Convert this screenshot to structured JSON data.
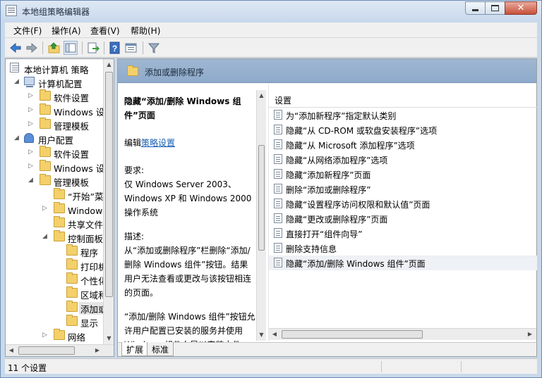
{
  "window": {
    "title": "本地组策略编辑器"
  },
  "menu": [
    "文件(F)",
    "操作(A)",
    "查看(V)",
    "帮助(H)"
  ],
  "toolbar": {
    "icons": [
      "back-arrow-icon",
      "forward-arrow-icon",
      "up-folder-icon",
      "show-hide-tree-icon",
      "export-list-icon",
      "help-icon",
      "properties-icon",
      "filter-icon"
    ]
  },
  "tree": {
    "items": [
      {
        "label": "本地计算机 策略"
      },
      {
        "label": "计算机配置"
      },
      {
        "label": "软件设置"
      },
      {
        "label": "Windows 设置"
      },
      {
        "label": "管理模板"
      },
      {
        "label": "用户配置"
      },
      {
        "label": "软件设置"
      },
      {
        "label": "Windows 设置"
      },
      {
        "label": "管理模板"
      },
      {
        "label": "“开始”菜单和任务栏"
      },
      {
        "label": "Windows 组件"
      },
      {
        "label": "共享文件夹"
      },
      {
        "label": "控制面板"
      },
      {
        "label": "程序"
      },
      {
        "label": "打印机"
      },
      {
        "label": "个性化"
      },
      {
        "label": "区域和语言选项"
      },
      {
        "label": "添加或删除程序"
      },
      {
        "label": "显示"
      },
      {
        "label": "网络"
      }
    ]
  },
  "right": {
    "header_title": "添加或删除程序",
    "description": {
      "title": "隐藏“添加/删除 Windows 组件”页面",
      "edit_prefix": "编辑",
      "edit_link": "策略设置",
      "requirements_label": "要求:",
      "requirements_text": "仅 Windows Server 2003、Windows XP 和 Windows 2000 操作系统",
      "description_label": "描述:",
      "description_text": "从“添加或删除程序”栏删除“添加/删除 Windows 组件”按钮。结果用户无法查看或更改与该按钮相连的页面。",
      "description_text2": "“添加/删除 Windows 组件”按钮允许用户配置已安装的服务并使用 Windows 组件向导以安装文件"
    },
    "list_column": "设置",
    "settings": [
      "为“添加新程序”指定默认类别",
      "隐藏“从 CD-ROM 或软盘安装程序”选项",
      "隐藏“从 Microsoft 添加程序”选项",
      "隐藏“从网络添加程序”选项",
      "隐藏“添加新程序”页面",
      "删除“添加或删除程序”",
      "隐藏“设置程序访问权限和默认值”页面",
      "隐藏“更改或删除程序”页面",
      "直接打开“组件向导”",
      "删除支持信息",
      "隐藏“添加/删除 Windows 组件”页面"
    ],
    "tabs": [
      "扩展",
      "标准"
    ]
  },
  "status": {
    "text": "11 个设置"
  }
}
